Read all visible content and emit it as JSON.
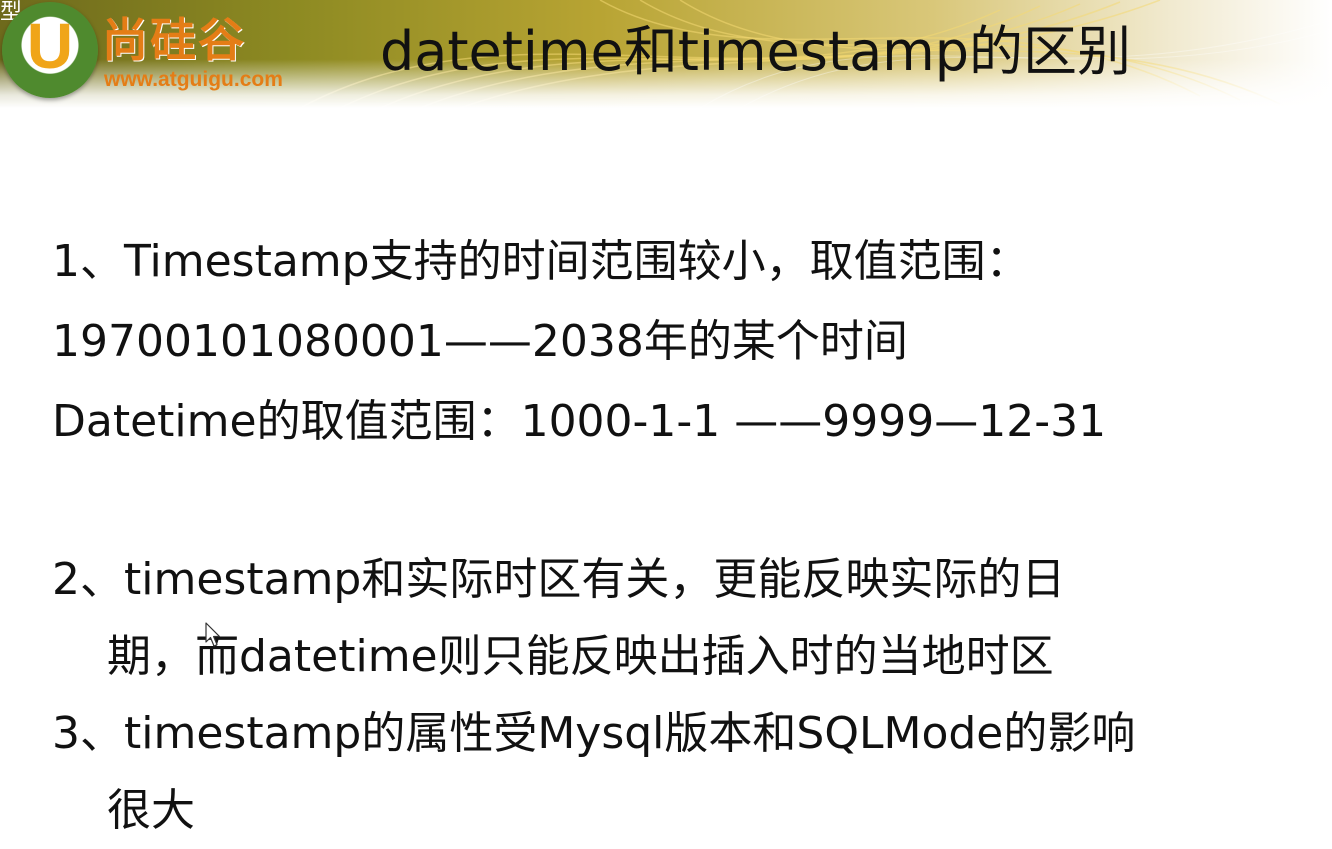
{
  "corner_glyph": "型",
  "logo": {
    "letter": "U",
    "name": "尚硅谷",
    "url": "www.atguigu.com"
  },
  "title": "datetime和timestamp的区别",
  "content": {
    "p1_line1": "1、Timestamp支持的时间范围较小，取值范围：",
    "p1_line2": "19700101080001——2038年的某个时间",
    "p1_line3": "Datetime的取值范围：1000-1-1 ——9999—12-31",
    "p2_line1": "2、timestamp和实际时区有关，更能反映实际的日",
    "p2_line2": "期，而datetime则只能反映出插入时的当地时区",
    "p3_line1": "3、timestamp的属性受Mysql版本和SQLMode的影响",
    "p3_line2": "很大"
  },
  "colors": {
    "logo_orange": "#e47d16",
    "logo_green": "#4f8a2e",
    "header_olive": "#8d8a22",
    "text": "#111111"
  },
  "icons": [
    "mouse-pointer-icon"
  ]
}
